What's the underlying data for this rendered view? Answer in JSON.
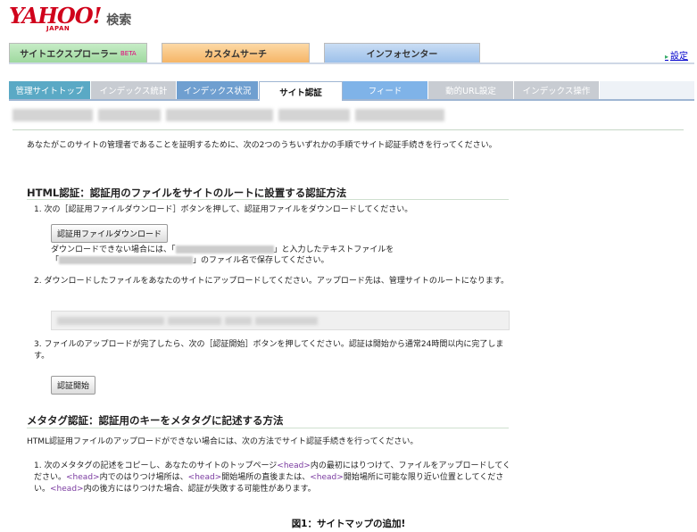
{
  "header": {
    "logo_text": "YAHOO!",
    "logo_sub": "JAPAN",
    "search_label": "検索",
    "settings_link": "設定"
  },
  "product_tabs": [
    {
      "label": "サイトエクスプローラー",
      "badge": "BETA"
    },
    {
      "label": "カスタムサーチ"
    },
    {
      "label": "インフォセンター"
    }
  ],
  "sub_tabs": [
    "管理サイトトップ",
    "インデックス統計",
    "インデックス状況",
    "サイト認証",
    "フィード",
    "動的URL設定",
    "インデックス操作"
  ],
  "main": {
    "intro": "あなたがこのサイトの管理者であることを証明するために、次の2つのうちいずれかの手順でサイト認証手続きを行ってください。",
    "html_section": {
      "heading": "HTML認証：認証用のファイルをサイトのルートに設置する認証方法",
      "step1": "1.  次の［認証用ファイルダウンロード］ボタンを押して、認証用ファイルをダウンロードしてください。",
      "download_button": "認証用ファイルダウンロード",
      "note_a": "ダウンロードできない場合には、「",
      "note_b": "」と入力したテキストファイルを",
      "note_c": "「",
      "note_d": "」のファイル名で保存してください。",
      "step2": "2.  ダウンロードしたファイルをあなたのサイトにアップロードしてください。アップロード先は、管理サイトのルートになります。",
      "step3": "3.  ファイルのアップロードが完了したら、次の［認証開始］ボタンを押してください。認証は開始から通常24時間以内に完了します。",
      "start_button": "認証開始"
    },
    "meta_section": {
      "heading": "メタタグ認証：認証用のキーをメタタグに記述する方法",
      "intro": "HTML認証用ファイルのアップロードができない場合には、次の方法でサイト認証手続きを行ってください。",
      "step1_a": "1.  次のメタタグの記述をコピーし、あなたのサイトのトップページ",
      "step1_b": "内の最初にはりつけて、ファイルをアップロードしてください。",
      "step1_c": "内でのはりつけ場所は、",
      "step1_d": "開始場所の直後または、",
      "step1_e": "開始場所に可能な限り近い位置としてください。",
      "step1_f": "内の後方にはりつけた場合、認証が失敗する可能性があります。",
      "head_tag": "<head>"
    }
  },
  "caption": "図1：サイトマップの追加!"
}
